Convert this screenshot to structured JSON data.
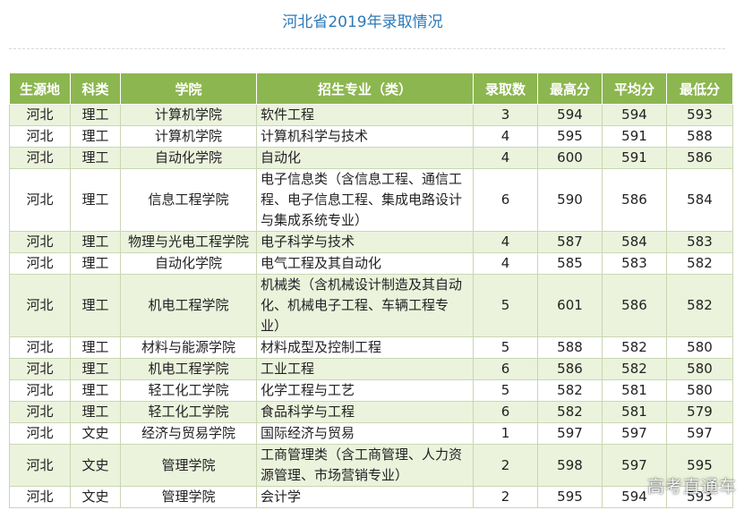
{
  "title": "河北省2019年录取情况",
  "table": {
    "headers": [
      "生源地",
      "科类",
      "学院",
      "招生专业（类）",
      "录取数",
      "最高分",
      "平均分",
      "最低分"
    ],
    "rows": [
      [
        "河北",
        "理工",
        "计算机学院",
        "软件工程",
        "3",
        "594",
        "594",
        "593"
      ],
      [
        "河北",
        "理工",
        "计算机学院",
        "计算机科学与技术",
        "4",
        "595",
        "591",
        "588"
      ],
      [
        "河北",
        "理工",
        "自动化学院",
        "自动化",
        "4",
        "600",
        "591",
        "586"
      ],
      [
        "河北",
        "理工",
        "信息工程学院",
        "电子信息类（含信息工程、通信工程、电子信息工程、集成电路设计与集成系统专业）",
        "6",
        "590",
        "586",
        "584"
      ],
      [
        "河北",
        "理工",
        "物理与光电工程学院",
        "电子科学与技术",
        "4",
        "587",
        "584",
        "583"
      ],
      [
        "河北",
        "理工",
        "自动化学院",
        "电气工程及其自动化",
        "4",
        "585",
        "583",
        "582"
      ],
      [
        "河北",
        "理工",
        "机电工程学院",
        "机械类（含机械设计制造及其自动化、机械电子工程、车辆工程专业）",
        "5",
        "601",
        "586",
        "582"
      ],
      [
        "河北",
        "理工",
        "材料与能源学院",
        "材料成型及控制工程",
        "5",
        "588",
        "582",
        "580"
      ],
      [
        "河北",
        "理工",
        "机电工程学院",
        "工业工程",
        "6",
        "586",
        "582",
        "580"
      ],
      [
        "河北",
        "理工",
        "轻工化工学院",
        "化学工程与工艺",
        "5",
        "582",
        "581",
        "580"
      ],
      [
        "河北",
        "理工",
        "轻工化工学院",
        "食品科学与工程",
        "6",
        "582",
        "581",
        "579"
      ],
      [
        "河北",
        "文史",
        "经济与贸易学院",
        "国际经济与贸易",
        "1",
        "597",
        "597",
        "597"
      ],
      [
        "河北",
        "文史",
        "管理学院",
        "工商管理类（含工商管理、人力资源管理、市场营销专业）",
        "2",
        "598",
        "597",
        "595"
      ],
      [
        "河北",
        "文史",
        "管理学院",
        "会计学",
        "2",
        "595",
        "594",
        "593"
      ]
    ]
  },
  "watermark": "高考直通车"
}
